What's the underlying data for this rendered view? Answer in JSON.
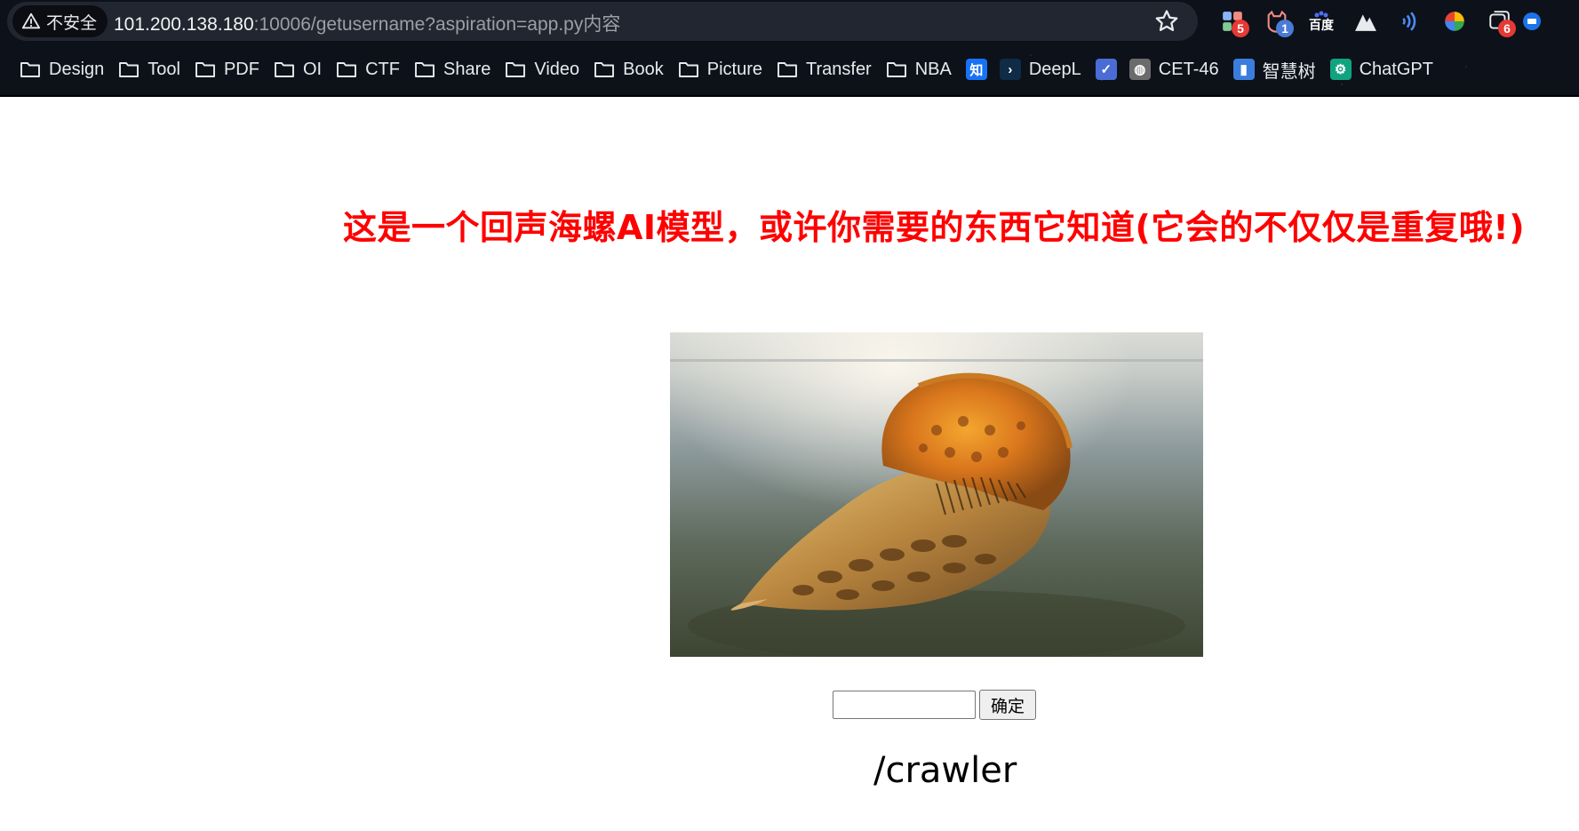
{
  "browser": {
    "security_label": "不安全",
    "url_host": "101.200.138.180",
    "url_rest": ":10006/getusername?aspiration=app.py内容",
    "extensions": [
      {
        "icon": "grid-extension-icon",
        "badge": "5",
        "badge_color": "#e53935"
      },
      {
        "icon": "cat-extension-icon",
        "badge": "1",
        "badge_color": "#4a7bd6"
      },
      {
        "icon": "baidu-icon",
        "label": "百度"
      },
      {
        "icon": "mountain-icon"
      },
      {
        "icon": "signal-icon"
      },
      {
        "icon": "color-circle-icon"
      },
      {
        "icon": "tabs-icon",
        "badge": "6",
        "badge_color": "#e53935"
      },
      {
        "icon": "translate-icon"
      }
    ],
    "bookmarks": [
      {
        "label": "Design",
        "type": "folder"
      },
      {
        "label": "Tool",
        "type": "folder"
      },
      {
        "label": "PDF",
        "type": "folder"
      },
      {
        "label": "OI",
        "type": "folder"
      },
      {
        "label": "CTF",
        "type": "folder"
      },
      {
        "label": "Share",
        "type": "folder"
      },
      {
        "label": "Video",
        "type": "folder"
      },
      {
        "label": "Book",
        "type": "folder"
      },
      {
        "label": "Picture",
        "type": "folder"
      },
      {
        "label": "Transfer",
        "type": "folder"
      },
      {
        "label": "NBA",
        "type": "folder"
      },
      {
        "label": "",
        "type": "site",
        "glyph": "知",
        "color": "#1772f6"
      },
      {
        "label": "DeepL",
        "type": "site",
        "glyph": "›",
        "color": "#0f2b46"
      },
      {
        "label": "",
        "type": "site",
        "glyph": "✓",
        "color": "#4a6cd4"
      },
      {
        "label": "CET-46",
        "type": "site",
        "glyph": "◍",
        "color": "#6b6b6b"
      },
      {
        "label": "智慧树",
        "type": "site",
        "glyph": "▮",
        "color": "#3b7ddd"
      },
      {
        "label": "ChatGPT",
        "type": "site",
        "glyph": "⚙",
        "color": "#10a37f"
      }
    ]
  },
  "page": {
    "headline": "这是一个回声海螺AI模型，或许你需要的东西它知道(它会的不仅仅是重复哦!)",
    "input_value": "",
    "confirm_label": "确定",
    "crawler_text": "/crawler"
  }
}
